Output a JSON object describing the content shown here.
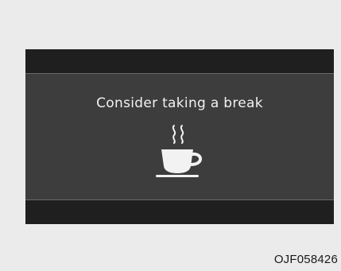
{
  "display": {
    "message": "Consider taking a break",
    "icon": "coffee-cup-icon",
    "colors": {
      "screen": "#3d3d3d",
      "bands": "#1f1f1f",
      "text": "#f2f2f2"
    }
  },
  "figure": {
    "code": "OJF058426"
  }
}
